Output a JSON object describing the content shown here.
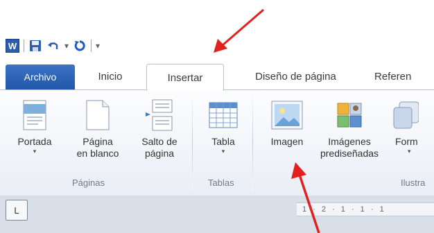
{
  "quick_access": {
    "app_icon": "W",
    "save_icon": "save-icon",
    "undo_icon": "undo-icon",
    "redo_icon": "redo-icon",
    "customize_icon": "customize-icon"
  },
  "tabs": [
    {
      "label": "Archivo"
    },
    {
      "label": "Inicio"
    },
    {
      "label": "Insertar"
    },
    {
      "label": "Diseño de página"
    },
    {
      "label": "Referen"
    }
  ],
  "groups": {
    "paginas": {
      "label": "Páginas",
      "commands": [
        {
          "line1": "Portada",
          "line2": ""
        },
        {
          "line1": "Página",
          "line2": "en blanco"
        },
        {
          "line1": "Salto de",
          "line2": "página"
        }
      ]
    },
    "tablas": {
      "label": "Tablas",
      "commands": [
        {
          "line1": "Tabla",
          "line2": ""
        }
      ]
    },
    "ilustraciones": {
      "label": "Ilustra",
      "commands": [
        {
          "line1": "Imagen",
          "line2": ""
        },
        {
          "line1": "Imágenes",
          "line2": "prediseñadas"
        },
        {
          "line1": "Form",
          "line2": ""
        }
      ]
    }
  },
  "ruler": {
    "corner_glyph": "L",
    "ticks": "1 · 2 · 1 · 1 · 1"
  },
  "colors": {
    "file_tab": "#2a62b5",
    "arrow": "#e4201e"
  }
}
